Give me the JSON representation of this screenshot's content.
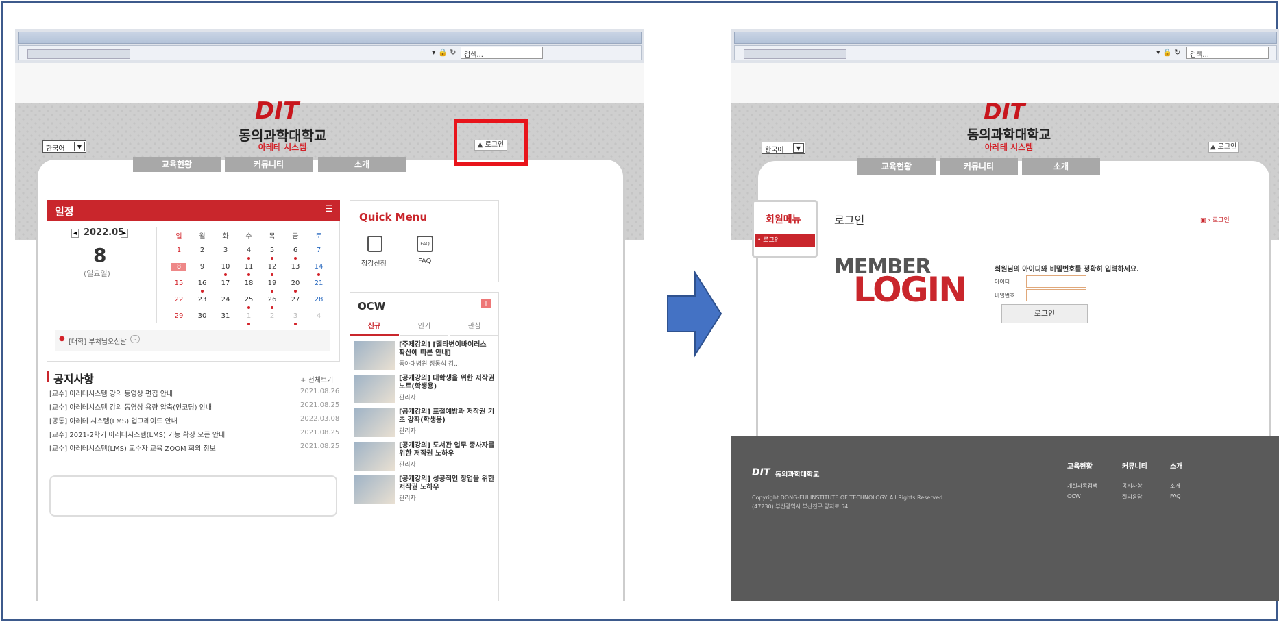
{
  "browser": {
    "search_label": "검색..."
  },
  "site": {
    "logo": "DIT",
    "university": "동의과학대학교",
    "system": "아레테 시스템",
    "language": "한국어",
    "login_button": "▲ 로그인",
    "nav": [
      "교육현황",
      "커뮤니티",
      "소개"
    ]
  },
  "schedule": {
    "title": "일정",
    "month": "2022.05",
    "day": "8",
    "weekday": "(일요일)",
    "weekdays": [
      "일",
      "월",
      "화",
      "수",
      "목",
      "금",
      "토"
    ],
    "rows": [
      [
        "1",
        "2",
        "3",
        "4",
        "5",
        "6",
        "7"
      ],
      [
        "8",
        "9",
        "10",
        "11",
        "12",
        "13",
        "14"
      ],
      [
        "15",
        "16",
        "17",
        "18",
        "19",
        "20",
        "21"
      ],
      [
        "22",
        "23",
        "24",
        "25",
        "26",
        "27",
        "28"
      ],
      [
        "29",
        "30",
        "31",
        "1",
        "2",
        "3",
        "4"
      ]
    ],
    "event": "[대학] 부처님오신날"
  },
  "quick_menu": {
    "title": "Quick Menu",
    "items": [
      "정강신청",
      "FAQ"
    ],
    "faq_icon": "FAQ"
  },
  "ocw": {
    "title": "OCW",
    "tabs": [
      "신규",
      "인기",
      "관심"
    ],
    "items": [
      {
        "title": "[주제강의] [델타변이바이러스 확산에 따른 안내]",
        "author": "동아대병원 정동식 감..."
      },
      {
        "title": "[공개강의] 대학생을 위한 저작권 노트(학생용)",
        "author": "관리자"
      },
      {
        "title": "[공개강의] 표절예방과 저작권 기초 강좌(학생용)",
        "author": "관리자"
      },
      {
        "title": "[공개강의] 도서관 업무 종사자를 위한 저작권 노하우",
        "author": "관리자"
      },
      {
        "title": "[공개강의] 성공적인 창업을 위한 저작권 노하우",
        "author": "관리자"
      }
    ]
  },
  "notices": {
    "title": "공지사항",
    "more": "+ 전체보기",
    "items": [
      {
        "text": "[교수] 아레테시스템 강의 동영상 편집 안내",
        "date": "2021.08.26"
      },
      {
        "text": "[교수] 아레테시스템 강의 동영상 용량 압축(인코딩) 안내",
        "date": "2021.08.25"
      },
      {
        "text": "[공통] 아레테 시스템(LMS) 업그레이드 안내",
        "date": "2022.03.08"
      },
      {
        "text": "[교수] 2021-2학기 아레테시스템(LMS) 기능 확장 오픈 안내",
        "date": "2021.08.25"
      },
      {
        "text": "[교수] 아레테시스템(LMS) 교수자 교육 ZOOM 회의 정보",
        "date": "2021.08.25"
      }
    ]
  },
  "login_page": {
    "side_title": "회원메뉴",
    "side_item": "• 로그인",
    "heading": "로그인",
    "breadcrumb": "▣ › 로그인",
    "member": "MEMBER",
    "login_big": "LOGIN",
    "instruction": "회원님의 아이디와 비밀번호를 정확히 입력하세요.",
    "id_label": "아이디",
    "pw_label": "비밀번호",
    "submit": "로그인"
  },
  "footer": {
    "logo": "DIT",
    "name": "동의과학대학교",
    "copyright": "Copyright DONG-EUI INSTITUTE OF TECHNOLOGY. All Rights Reserved.",
    "address": "(47230) 부산광역시 부산진구 양지로 54",
    "cols": [
      {
        "title": "교육현황",
        "links": [
          "개설과목검색",
          "OCW"
        ]
      },
      {
        "title": "커뮤니티",
        "links": [
          "공지사항",
          "질의응답"
        ]
      },
      {
        "title": "소개",
        "links": [
          "소개",
          "FAQ"
        ]
      }
    ]
  },
  "colors": {
    "accent": "#c9262c",
    "arrow": "#4472c4",
    "highlight": "#e8141b"
  }
}
